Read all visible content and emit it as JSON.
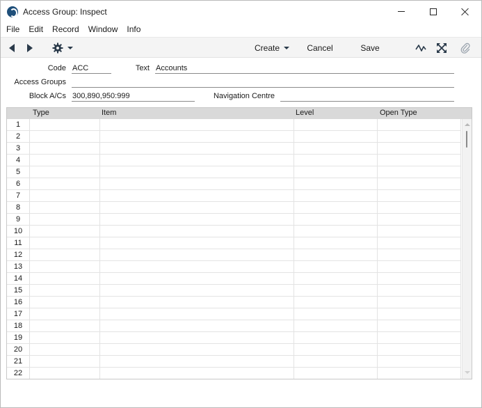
{
  "window": {
    "title": "Access Group: Inspect"
  },
  "menu": [
    "File",
    "Edit",
    "Record",
    "Window",
    "Info"
  ],
  "toolbar": {
    "create_label": "Create",
    "cancel_label": "Cancel",
    "save_label": "Save"
  },
  "form": {
    "code_label": "Code",
    "code_value": "ACC",
    "text_label": "Text",
    "text_value": "Accounts",
    "access_groups_label": "Access Groups",
    "access_groups_value": "",
    "block_label": "Block A/Cs",
    "block_value": "300,890,950:999",
    "nav_label": "Navigation Centre",
    "nav_value": ""
  },
  "grid": {
    "columns": [
      "Type",
      "Item",
      "Level",
      "Open Type"
    ],
    "row_numbers": [
      "1",
      "2",
      "3",
      "4",
      "5",
      "6",
      "7",
      "8",
      "9",
      "10",
      "11",
      "12",
      "13",
      "14",
      "15",
      "16",
      "17",
      "18",
      "19",
      "20",
      "21",
      "22"
    ]
  },
  "icons": {
    "app": "app-logo-icon",
    "prev": "arrow-left-icon",
    "next": "arrow-right-icon",
    "settings": "gear-icon",
    "activity": "pulse-icon",
    "expand": "expand-icon",
    "attach": "paperclip-icon"
  },
  "colors": {
    "toolbar_bg": "#f4f4f4",
    "grid_header_bg": "#d9d9d9",
    "icon_dark": "#2a3a4a"
  }
}
